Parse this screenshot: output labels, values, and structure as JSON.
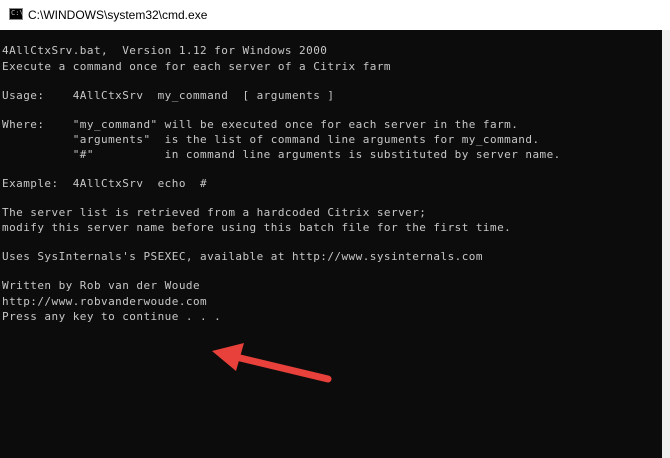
{
  "window": {
    "title": "C:\\WINDOWS\\system32\\cmd.exe",
    "app_icon": "cmd-icon",
    "icon_prompt": "C:\\"
  },
  "console": {
    "background": "#0c0c0c",
    "text_color": "#c7c7c7",
    "lines": [
      "4AllCtxSrv.bat,  Version 1.12 for Windows 2000",
      "Execute a command once for each server of a Citrix farm",
      "",
      "Usage:    4AllCtxSrv  my_command  [ arguments ]",
      "",
      "Where:    \"my_command\" will be executed once for each server in the farm.",
      "          \"arguments\"  is the list of command line arguments for my_command.",
      "          \"#\"          in command line arguments is substituted by server name.",
      "",
      "Example:  4AllCtxSrv  echo  #",
      "",
      "The server list is retrieved from a hardcoded Citrix server;",
      "modify this server name before using this batch file for the first time.",
      "",
      "Uses SysInternals's PSEXEC, available at http://www.sysinternals.com",
      "",
      "Written by Rob van der Woude",
      "http://www.robvanderwoude.com",
      "Press any key to continue . . ."
    ]
  },
  "annotation": {
    "arrow_color": "#e8403a",
    "arrow_icon": "red-arrow-pointer"
  }
}
